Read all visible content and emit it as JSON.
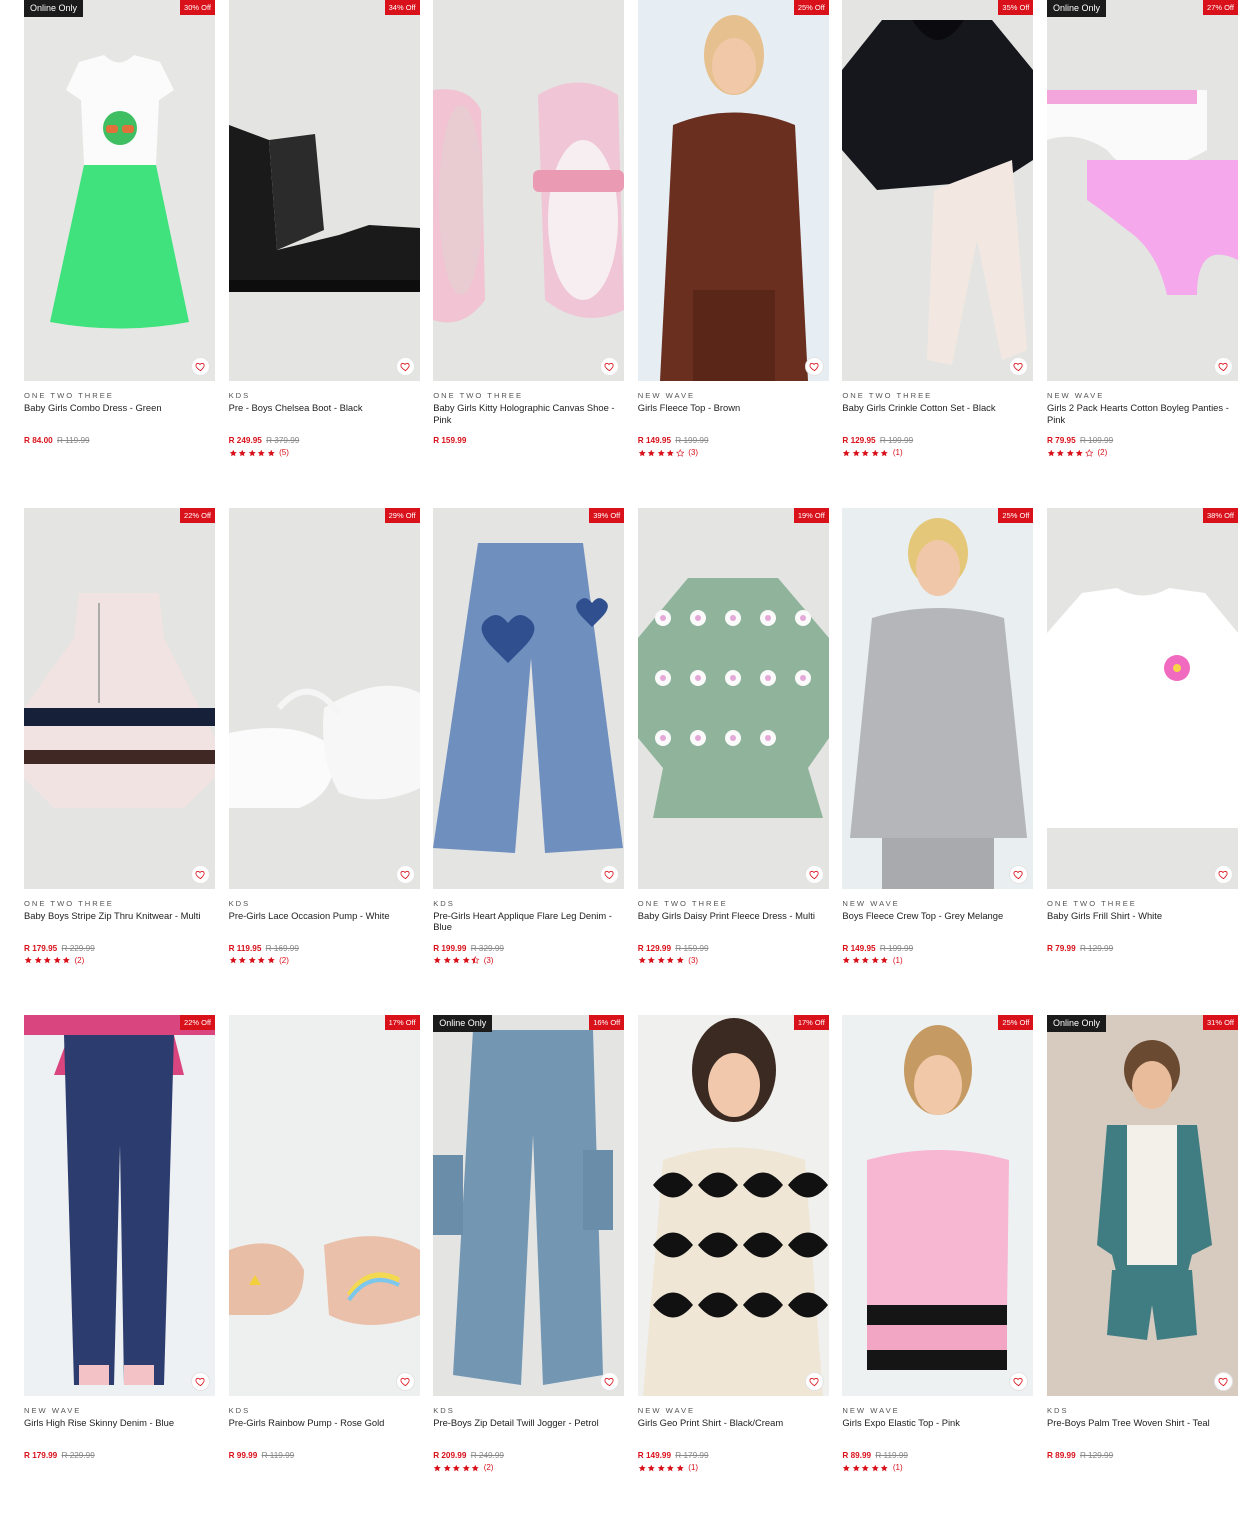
{
  "products": [
    {
      "badge": "Online Only",
      "discount": "30% Off",
      "brand": "ONE TWO THREE",
      "title": "Baby Girls Combo Dress - Green",
      "price": "R 84.00",
      "was": "R 119.99",
      "rating": null,
      "reviews": null,
      "art": "dress"
    },
    {
      "badge": null,
      "discount": "34% Off",
      "brand": "KDS",
      "title": "Pre - Boys Chelsea Boot - Black",
      "price": "R 249.95",
      "was": "R 379.99",
      "rating": 5,
      "reviews": "(5)",
      "art": "boot"
    },
    {
      "badge": null,
      "discount": null,
      "brand": "ONE TWO THREE",
      "title": "Baby Girls Kitty Holographic Canvas Shoe - Pink",
      "price": "R 159.99",
      "was": null,
      "rating": null,
      "reviews": null,
      "art": "kittyshoe"
    },
    {
      "badge": null,
      "discount": "25% Off",
      "brand": "NEW WAVE",
      "title": "Girls Fleece Top - Brown",
      "price": "R 149.95",
      "was": "R 199.99",
      "rating": 4,
      "reviews": "(3)",
      "art": "model-brown"
    },
    {
      "badge": null,
      "discount": "35% Off",
      "brand": "ONE TWO THREE",
      "title": "Baby Girls Crinkle Cotton Set - Black",
      "price": "R 129.95",
      "was": "R 199.99",
      "rating": 5,
      "reviews": "(1)",
      "art": "set-black"
    },
    {
      "badge": "Online Only",
      "discount": "27% Off",
      "brand": "NEW WAVE",
      "title": "Girls 2 Pack Hearts Cotton Boyleg Panties - Pink",
      "price": "R 79.95",
      "was": "R 109.99",
      "rating": 4,
      "reviews": "(2)",
      "art": "panties"
    },
    {
      "badge": null,
      "discount": "22% Off",
      "brand": "ONE TWO THREE",
      "title": "Baby Boys Stripe Zip Thru Knitwear - Multi",
      "price": "R 179.95",
      "was": "R 229.99",
      "rating": 5,
      "reviews": "(2)",
      "art": "knit"
    },
    {
      "badge": null,
      "discount": "29% Off",
      "brand": "KDS",
      "title": "Pre-Girls Lace Occasion Pump - White",
      "price": "R 119.95",
      "was": "R 169.99",
      "rating": 5,
      "reviews": "(2)",
      "art": "pump-white"
    },
    {
      "badge": null,
      "discount": "39% Off",
      "brand": "KDS",
      "title": "Pre-Girls Heart Applique Flare Leg Denim - Blue",
      "price": "R 199.99",
      "was": "R 329.99",
      "rating": 4.5,
      "reviews": "(3)",
      "art": "denim-heart"
    },
    {
      "badge": null,
      "discount": "19% Off",
      "brand": "ONE TWO THREE",
      "title": "Baby Girls Daisy Print Fleece Dress - Multi",
      "price": "R 129.99",
      "was": "R 159.99",
      "rating": 5,
      "reviews": "(3)",
      "art": "daisy"
    },
    {
      "badge": null,
      "discount": "25% Off",
      "brand": "NEW WAVE",
      "title": "Boys Fleece Crew Top - Grey Melange",
      "price": "R 149.95",
      "was": "R 199.99",
      "rating": 5,
      "reviews": "(1)",
      "art": "model-grey"
    },
    {
      "badge": null,
      "discount": "38% Off",
      "brand": "ONE TWO THREE",
      "title": "Baby Girls Frill Shirt - White",
      "price": "R 79.99",
      "was": "R 129.99",
      "rating": null,
      "reviews": null,
      "art": "frill-shirt"
    },
    {
      "badge": null,
      "discount": "22% Off",
      "brand": "NEW WAVE",
      "title": "Girls High Rise Skinny Denim - Blue",
      "price": "R 179.99",
      "was": "R 229.99",
      "rating": null,
      "reviews": null,
      "art": "model-denim"
    },
    {
      "badge": null,
      "discount": "17% Off",
      "brand": "KDS",
      "title": "Pre-Girls Rainbow Pump - Rose Gold",
      "price": "R 99.99",
      "was": "R 119.99",
      "rating": null,
      "reviews": null,
      "art": "pump-rose"
    },
    {
      "badge": "Online Only",
      "discount": "16% Off",
      "brand": "KDS",
      "title": "Pre-Boys Zip Detail Twill Jogger - Petrol",
      "price": "R 209.99",
      "was": "R 249.99",
      "rating": 5,
      "reviews": "(2)",
      "art": "jogger"
    },
    {
      "badge": null,
      "discount": "17% Off",
      "brand": "NEW WAVE",
      "title": "Girls Geo Print Shirt - Black/Cream",
      "price": "R 149.99",
      "was": "R 179.99",
      "rating": 5,
      "reviews": "(1)",
      "art": "model-geo"
    },
    {
      "badge": null,
      "discount": "25% Off",
      "brand": "NEW WAVE",
      "title": "Girls Expo Elastic Top - Pink",
      "price": "R 89.99",
      "was": "R 119.99",
      "rating": 5,
      "reviews": "(1)",
      "art": "model-pink"
    },
    {
      "badge": "Online Only",
      "discount": "31% Off",
      "brand": "KDS",
      "title": "Pre-Boys Palm Tree Woven Shirt - Teal",
      "price": "R 89.99",
      "was": "R 129.99",
      "rating": null,
      "reviews": null,
      "art": "model-boy-teal"
    }
  ],
  "icons": {
    "wishlist": "heart-outline-icon",
    "star": "star-icon"
  },
  "colors": {
    "sale_red": "#d9111b",
    "badge_dark": "#1b1b1b",
    "image_bg": "#e4e4e2"
  }
}
